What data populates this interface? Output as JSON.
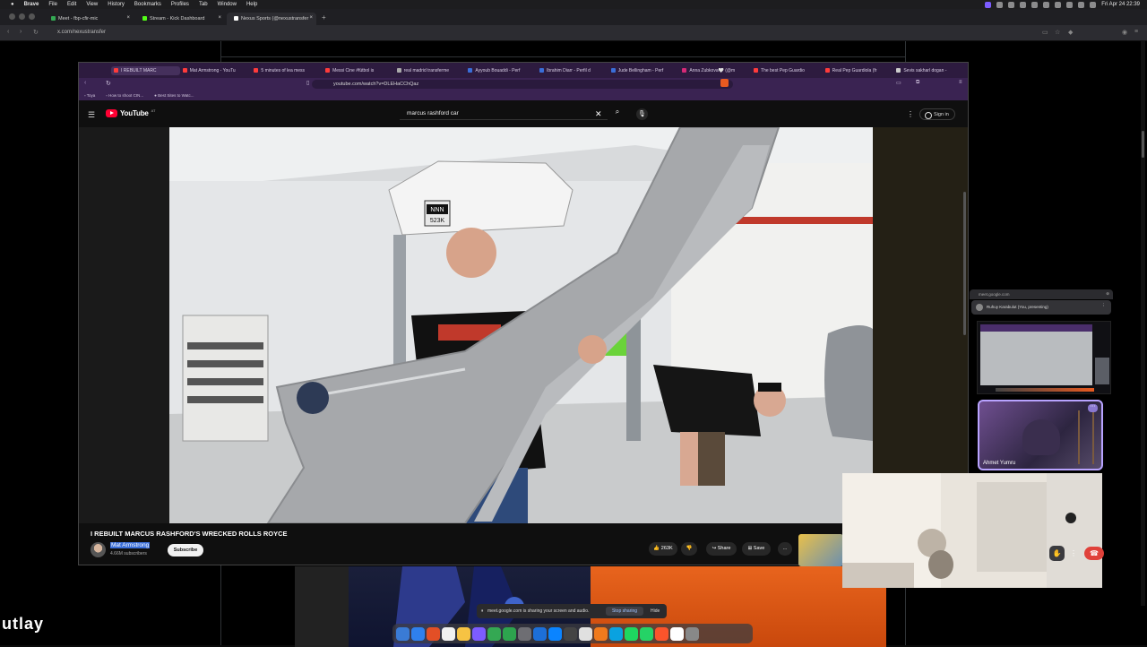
{
  "menubar": {
    "app": "Brave",
    "items": [
      "File",
      "Edit",
      "View",
      "History",
      "Bookmarks",
      "Profiles",
      "Tab",
      "Window",
      "Help"
    ],
    "clock": "Fri Apr 24  22:39"
  },
  "outer_browser": {
    "tabs": [
      {
        "label": "Meet - fbp-cfir-mic",
        "color": "#34a853"
      },
      {
        "label": "Stream - Kick Dashboard",
        "color": "#53fc18"
      },
      {
        "label": "Nexus Sports (@nexustransfer",
        "color": "#ffffff"
      }
    ],
    "url": "x.com/nexustransfer",
    "edge_text": "utlay"
  },
  "inner_browser": {
    "tabs": [
      "I REBUILT MARC",
      "Mat Armstrong - YouTu",
      "5 minutes of lea mess",
      "Messi Cine #fútbol is",
      "real madrid transferme",
      "Ayyoub Bouaddi - Perf",
      "Ibrahim Diarr - Perfil d",
      "Jude Bellingham - Perf",
      "Anna Zubkova🤍 (@m",
      "The best Pep Guardio",
      "Real Pep Guardiola (fr",
      "Sevis sakharl dogan -"
    ],
    "url": "youtube.com/watch?v=DLEHaCChQaz",
    "bookmarks": [
      "Toya",
      "How to shoot CIN...",
      "Best Sites to Watc..."
    ]
  },
  "youtube": {
    "logo": "YouTube",
    "country": "AT",
    "search_query": "marcus rashford car",
    "sign_in": "Sign in",
    "video_title": "I REBUILT MARCUS RASHFORD'S WRECKED ROLLS ROYCE",
    "channel": "Mat Armstrong",
    "subscribers": "4.66M subscribers",
    "subscribe": "Subscribe",
    "likes": "263K",
    "share": "Share",
    "save": "Save",
    "plate_line1": "NNN",
    "plate_line2": "523K"
  },
  "meet": {
    "url": "meet.google.com",
    "presenting": "Ruhuy Karabulut (You, presenting)",
    "participant": "Ahmet Yumru"
  },
  "share_banner": {
    "text": "meet.google.com is sharing your screen and audio.",
    "stop": "Stop sharing",
    "hide": "Hide"
  },
  "colors": {
    "yt_red": "#ff0033",
    "inner_chrome": "#2d1b3f",
    "meet_end": "#e0413a",
    "tile_border": "#b8a3ff"
  },
  "dock_colors": [
    "#3a7bd5",
    "#2f80ed",
    "#e34f26",
    "#f0f0f0",
    "#f6c343",
    "#7c5cff",
    "#34a853",
    "#2da44e",
    "#6e6e73",
    "#1d6fd8",
    "#0a84ff",
    "#444",
    "#e0e0e0",
    "#f07a1d",
    "#0aa2e0",
    "#1ed760",
    "#25d366",
    "#fb542b",
    "#ffffff",
    "#888"
  ]
}
